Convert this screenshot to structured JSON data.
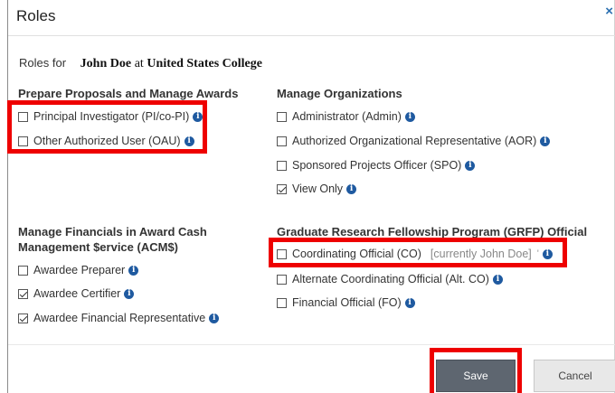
{
  "dialog": {
    "title": "Roles",
    "close_glyph": "×"
  },
  "roles_for": {
    "label": "Roles for",
    "name": "John Doe",
    "at": "at",
    "org": "United States College"
  },
  "sections": {
    "awards": {
      "title": "Prepare Proposals and Manage Awards",
      "items": [
        {
          "label": "Principal Investigator (PI/co-PI)",
          "checked": false
        },
        {
          "label": "Other Authorized User (OAU)",
          "checked": false
        }
      ]
    },
    "orgs": {
      "title": "Manage Organizations",
      "items": [
        {
          "label": "Administrator (Admin)",
          "checked": false
        },
        {
          "label": "Authorized Organizational Representative (AOR)",
          "checked": false
        },
        {
          "label": "Sponsored Projects Officer (SPO)",
          "checked": false
        },
        {
          "label": "View Only",
          "checked": true
        }
      ]
    },
    "financials": {
      "title_line1": "Manage Financials in Award Cash",
      "title_line2": "Management $ervice (ACM$)",
      "items": [
        {
          "label": "Awardee Preparer",
          "checked": false
        },
        {
          "label": "Awardee Certifier",
          "checked": true
        },
        {
          "label": "Awardee Financial Representative",
          "checked": true
        }
      ]
    },
    "grfp": {
      "title": "Graduate Research Fellowship Program (GRFP) Official",
      "items": [
        {
          "label": "Coordinating Official (CO)",
          "current": "[currently John Doe]",
          "tick": "'",
          "checked": false
        },
        {
          "label": "Alternate Coordinating Official (Alt. CO)",
          "checked": false
        },
        {
          "label": "Financial Official (FO)",
          "checked": false
        }
      ]
    }
  },
  "info_glyph": "i",
  "buttons": {
    "save": "Save",
    "cancel": "Cancel"
  },
  "colors": {
    "highlight": "#ee0000",
    "info_icon": "#1f5aa0",
    "save_bg": "#5e6670"
  }
}
